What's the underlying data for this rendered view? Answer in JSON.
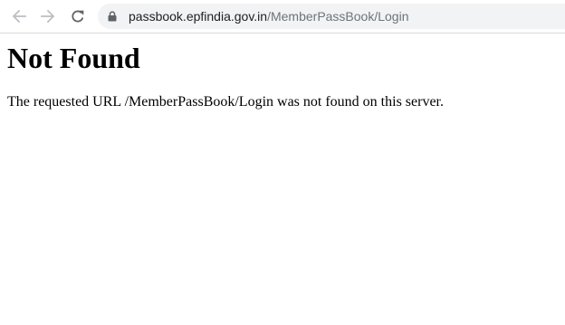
{
  "browser": {
    "back_icon": "arrow-left-icon",
    "forward_icon": "arrow-right-icon",
    "reload_icon": "reload-icon",
    "lock_icon": "lock-icon",
    "url_host": "passbook.epfindia.gov.in",
    "url_path": "/MemberPassBook/Login"
  },
  "page": {
    "heading": "Not Found",
    "message": "The requested URL /MemberPassBook/Login was not found on this server."
  },
  "colors": {
    "nav_icon_disabled": "#bdbfc2",
    "nav_icon_enabled": "#5f6368",
    "omnibox_bg": "#f1f3f4",
    "url_host": "#202124",
    "url_path": "#6f7378"
  }
}
